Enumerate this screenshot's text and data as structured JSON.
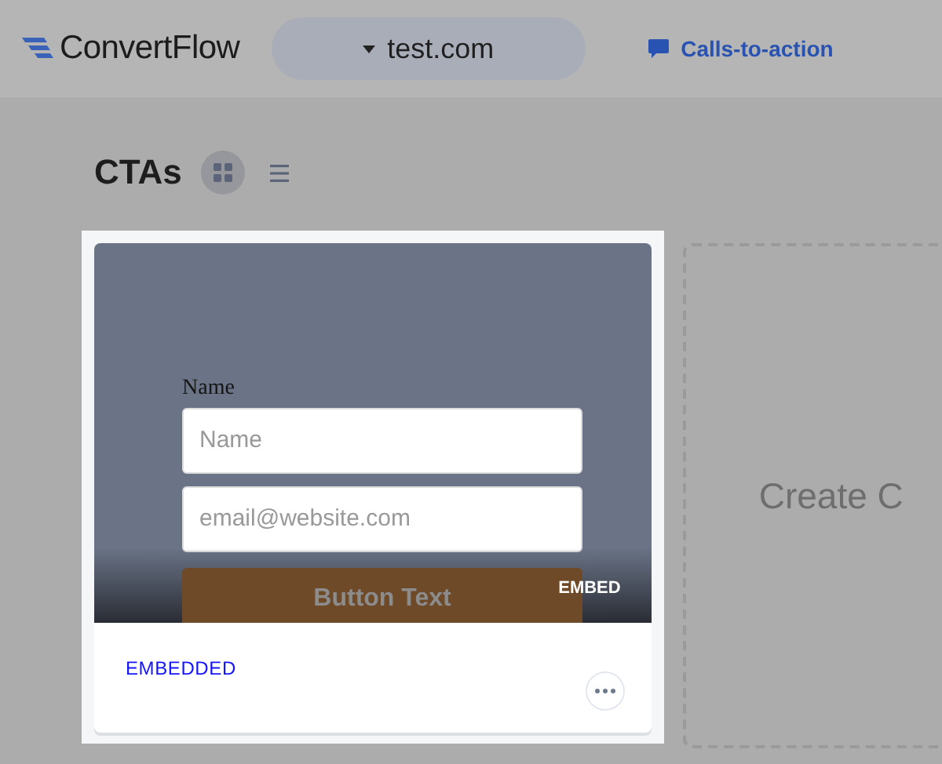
{
  "header": {
    "logo": "ConvertFlow",
    "site_selector": "test.com",
    "nav_link": "Calls-to-action"
  },
  "page": {
    "title": "CTAs",
    "views": [
      {
        "kind": "grid",
        "selected": true
      },
      {
        "kind": "list",
        "selected": false
      }
    ]
  },
  "cards": [
    {
      "preview": {
        "label": "Name",
        "fields": [
          {
            "placeholder": "Name"
          },
          {
            "placeholder": "email@website.com"
          }
        ],
        "button": "Button Text",
        "badge": "EMBED"
      },
      "type": "EMBEDDED"
    }
  ],
  "create_card": {
    "label": "Create C"
  }
}
